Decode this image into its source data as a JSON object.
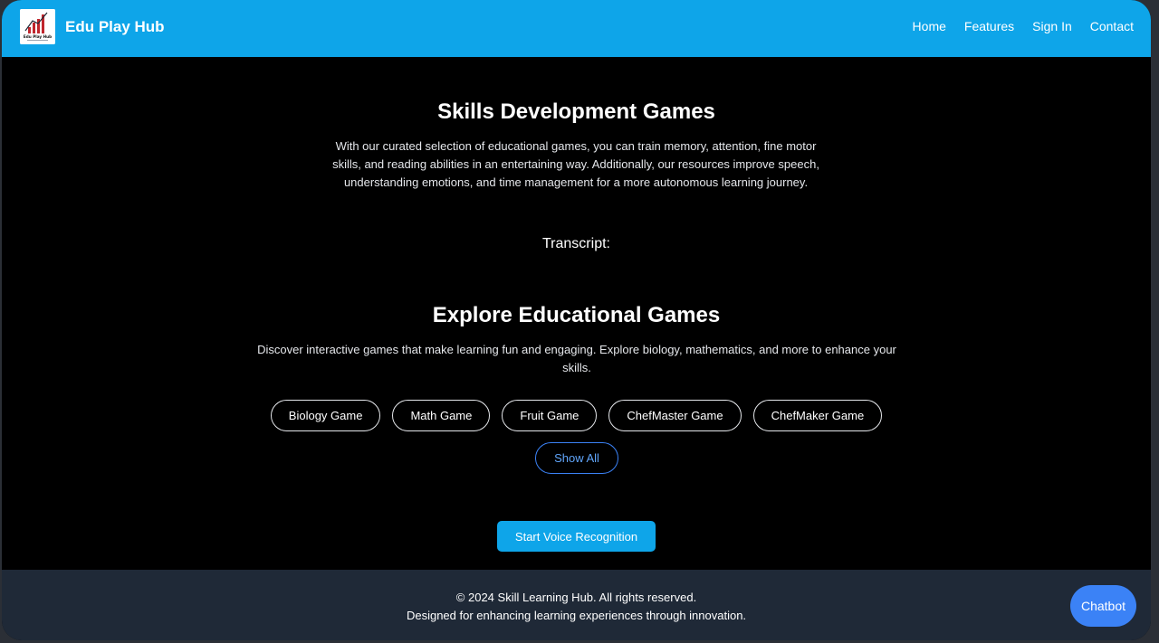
{
  "header": {
    "brand": "Edu Play Hub",
    "logo_text": "Edu Play Hub",
    "nav": [
      "Home",
      "Features",
      "Sign In",
      "Contact"
    ]
  },
  "skills": {
    "title": "Skills Development Games",
    "description": "With our curated selection of educational games, you can train memory, attention, fine motor skills, and reading abilities in an entertaining way. Additionally, our resources improve speech, understanding emotions, and time management for a more autonomous learning journey."
  },
  "transcript_label": "Transcript:",
  "explore": {
    "title": "Explore Educational Games",
    "description": "Discover interactive games that make learning fun and engaging. Explore biology, mathematics, and more to enhance your skills.",
    "games": [
      "Biology Game",
      "Math Game",
      "Fruit Game",
      "ChefMaster Game",
      "ChefMaker Game"
    ],
    "show_all": "Show All"
  },
  "voice_button": "Start Voice Recognition",
  "footer": {
    "copyright": "© 2024 Skill Learning Hub. All rights reserved.",
    "tagline": "Designed for enhancing learning experiences through innovation."
  },
  "chatbot_label": "Chatbot",
  "colors": {
    "header_bg": "#0ea5e9",
    "page_bg": "#000000",
    "footer_bg": "#1f2937",
    "accent_blue": "#3b82f6"
  }
}
